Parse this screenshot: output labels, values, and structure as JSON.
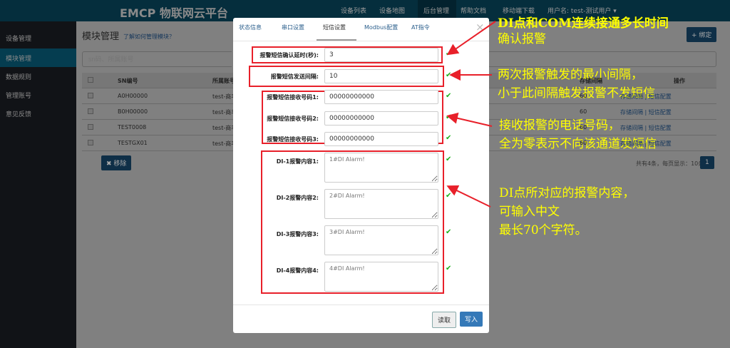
{
  "header": {
    "logo": "EMCP 物联网云平台",
    "nav": [
      "设备列表",
      "设备地图",
      "后台管理",
      "帮助文档",
      "移动端下载",
      "用户名: test-测试用户 ▾"
    ]
  },
  "sidebar": {
    "items": [
      "设备管理",
      "模块管理",
      "数据规则",
      "管理账号",
      "意见反馈"
    ]
  },
  "page": {
    "title": "模块管理",
    "help_link": "了解如何管理模块？",
    "bind_button": "+ 绑定",
    "search_placeholder": "sn码、所属账号",
    "columns": [
      "SN编号",
      "所属账号",
      "存储间隔",
      "操作"
    ],
    "rows": [
      {
        "sn": "A0H00000",
        "account": "test-商丰",
        "interval": "60",
        "ops": "存储间隔 | 短信配置"
      },
      {
        "sn": "B0H00000",
        "account": "test-商丰",
        "interval": "60",
        "ops": "存储间隔 | 短信配置"
      },
      {
        "sn": "TEST0008",
        "account": "test-商丰",
        "interval": "60",
        "ops": "存储间隔 | 短信配置"
      },
      {
        "sn": "TESTGX01",
        "account": "test-商丰",
        "interval": "60",
        "ops": "存储间隔 | 短信配置"
      }
    ],
    "remove_button": "✖ 移除",
    "pagination_info": "共有4条，每页显示：10条",
    "page_number": "1"
  },
  "modal": {
    "tabs": [
      "状态信息",
      "串口设置",
      "短信设置",
      "Modbus配置",
      "AT指令"
    ],
    "close": "×",
    "fields": [
      {
        "label": "报警短信确认延时(秒):",
        "value": "3"
      },
      {
        "label": "报警短信发送间隔:",
        "value": "10"
      },
      {
        "label": "报警短信接收号码1:",
        "value": "00000000000"
      },
      {
        "label": "报警短信接收号码2:",
        "value": "00000000000"
      },
      {
        "label": "报警短信接收号码3:",
        "value": "00000000000"
      }
    ],
    "textareas": [
      {
        "label": "DI-1报警内容1:",
        "value": "1#DI Alarm!"
      },
      {
        "label": "DI-2报警内容2:",
        "value": "2#DI Alarm!"
      },
      {
        "label": "DI-3报警内容3:",
        "value": "3#DI Alarm!"
      },
      {
        "label": "DI-4报警内容4:",
        "value": "4#DI Alarm!"
      }
    ],
    "read_button": "读取",
    "write_button": "写入",
    "check": "✔"
  },
  "annotations": [
    "DI点和COM连续接通多长时间",
    "确认报警",
    "两次报警触发的最小间隔，",
    "小于此间隔触发报警不发短信",
    "接收报警的电话号码，",
    "全为零表示不向该通道发短信",
    "DI点所对应的报警内容，",
    "可输入中文",
    "最长70个字符。"
  ]
}
